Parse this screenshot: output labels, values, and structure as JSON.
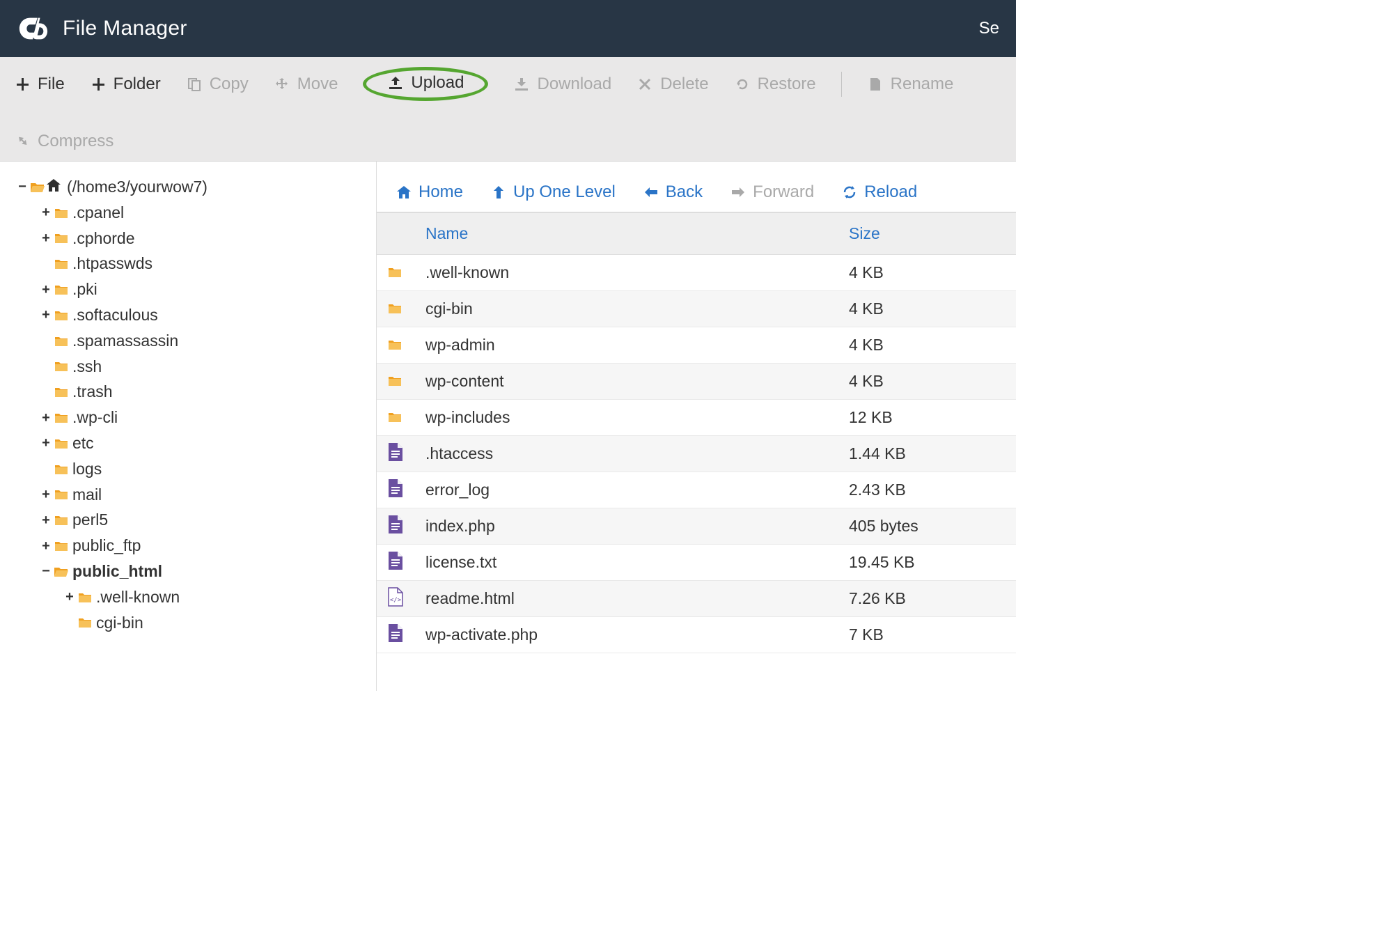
{
  "header": {
    "title": "File Manager",
    "right_fragment": "Se"
  },
  "toolbar": {
    "file": "File",
    "folder": "Folder",
    "copy": "Copy",
    "move": "Move",
    "upload": "Upload",
    "download": "Download",
    "delete": "Delete",
    "restore": "Restore",
    "rename": "Rename",
    "compress": "Compress"
  },
  "tree": {
    "root_label": "(/home3/yourwow7)",
    "items": [
      {
        "toggle": "+",
        "label": ".cpanel"
      },
      {
        "toggle": "+",
        "label": ".cphorde"
      },
      {
        "toggle": "",
        "label": ".htpasswds"
      },
      {
        "toggle": "+",
        "label": ".pki"
      },
      {
        "toggle": "+",
        "label": ".softaculous"
      },
      {
        "toggle": "",
        "label": ".spamassassin"
      },
      {
        "toggle": "",
        "label": ".ssh"
      },
      {
        "toggle": "",
        "label": ".trash"
      },
      {
        "toggle": "+",
        "label": ".wp-cli"
      },
      {
        "toggle": "+",
        "label": "etc"
      },
      {
        "toggle": "",
        "label": "logs"
      },
      {
        "toggle": "+",
        "label": "mail"
      },
      {
        "toggle": "+",
        "label": "perl5"
      },
      {
        "toggle": "+",
        "label": "public_ftp"
      }
    ],
    "public_html_label": "public_html",
    "public_html_children": [
      {
        "toggle": "+",
        "label": ".well-known"
      },
      {
        "toggle": "",
        "label": "cgi-bin"
      }
    ]
  },
  "nav": {
    "home": "Home",
    "up": "Up One Level",
    "back": "Back",
    "forward": "Forward",
    "reload": "Reload"
  },
  "table": {
    "col_name": "Name",
    "col_size": "Size",
    "rows": [
      {
        "type": "folder",
        "name": ".well-known",
        "size": "4 KB"
      },
      {
        "type": "folder",
        "name": "cgi-bin",
        "size": "4 KB"
      },
      {
        "type": "folder",
        "name": "wp-admin",
        "size": "4 KB"
      },
      {
        "type": "folder",
        "name": "wp-content",
        "size": "4 KB"
      },
      {
        "type": "folder",
        "name": "wp-includes",
        "size": "12 KB"
      },
      {
        "type": "file",
        "name": ".htaccess",
        "size": "1.44 KB"
      },
      {
        "type": "file",
        "name": "error_log",
        "size": "2.43 KB"
      },
      {
        "type": "file",
        "name": "index.php",
        "size": "405 bytes"
      },
      {
        "type": "file",
        "name": "license.txt",
        "size": "19.45 KB"
      },
      {
        "type": "html",
        "name": "readme.html",
        "size": "7.26 KB"
      },
      {
        "type": "file",
        "name": "wp-activate.php",
        "size": "7 KB"
      }
    ]
  },
  "colors": {
    "folder": "#f0a020",
    "file": "#6a4fa0",
    "link": "#2a74c7",
    "highlight": "#55a630"
  }
}
